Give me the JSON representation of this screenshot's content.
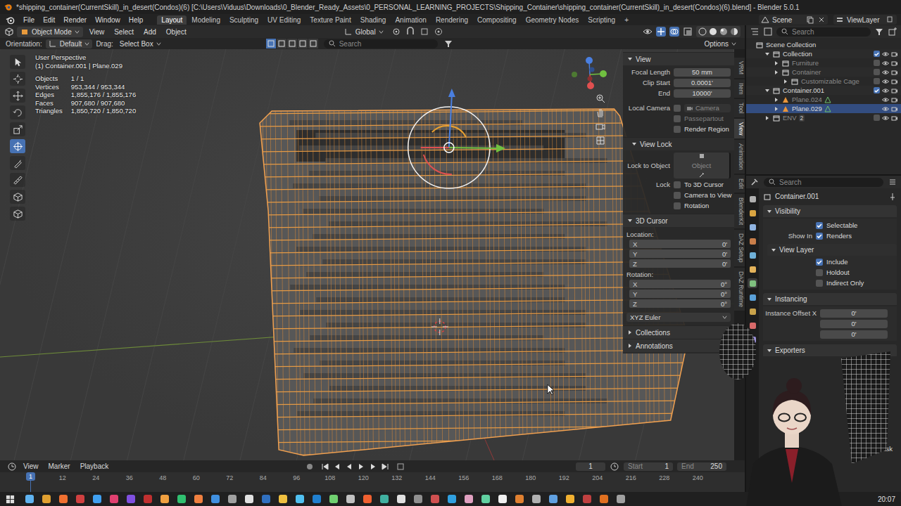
{
  "window": {
    "title": "*shipping_container(CurrentSkill)_in_desert(Condos)(6) [C:\\Users\\Viduus\\Downloads\\0_Blender_Ready_Assets\\0_PERSONAL_LEARNING_PROJECTS\\Shipping_Container\\shipping_container(CurrentSkill)_in_desert(Condos)(6).blend] - Blender 5.0.1"
  },
  "menu": [
    "File",
    "Edit",
    "Render",
    "Window",
    "Help"
  ],
  "workspaces": [
    {
      "label": "Layout",
      "selected": true
    },
    {
      "label": "Modeling",
      "selected": false
    },
    {
      "label": "Sculpting",
      "selected": false
    },
    {
      "label": "UV Editing",
      "selected": false
    },
    {
      "label": "Texture Paint",
      "selected": false
    },
    {
      "label": "Shading",
      "selected": false
    },
    {
      "label": "Animation",
      "selected": false
    },
    {
      "label": "Rendering",
      "selected": false
    },
    {
      "label": "Compositing",
      "selected": false
    },
    {
      "label": "Geometry Nodes",
      "selected": false
    },
    {
      "label": "Scripting",
      "selected": false
    }
  ],
  "add_workspace": "+",
  "scene": {
    "scene": "Scene",
    "view_layer": "ViewLayer"
  },
  "header": {
    "mode": "Object Mode",
    "menus": [
      "View",
      "Select",
      "Add",
      "Object"
    ],
    "transform": "Global"
  },
  "tool_settings": {
    "orientation_label": "Orientation:",
    "orientation": "Default",
    "drag_label": "Drag:",
    "drag": "Select Box",
    "search": "Search",
    "options": "Options"
  },
  "tools": [
    {
      "selected": false
    },
    {
      "selected": false
    },
    {
      "selected": false
    },
    {
      "selected": false
    },
    {
      "selected": false
    },
    {
      "selected": true
    },
    {
      "selected": false
    },
    {
      "selected": false
    },
    {
      "selected": false
    },
    {
      "selected": false
    }
  ],
  "viewport": {
    "perspective": "User Perspective",
    "active": "(1) Container.001 | Plane.029",
    "stats": [
      {
        "label": "Objects",
        "value": "1 / 1"
      },
      {
        "label": "Vertices",
        "value": "953,344 / 953,344"
      },
      {
        "label": "Edges",
        "value": "1,855,176 / 1,855,176"
      },
      {
        "label": "Faces",
        "value": "907,680 / 907,680"
      },
      {
        "label": "Triangles",
        "value": "1,850,720 / 1,850,720"
      }
    ]
  },
  "sidebar": {
    "view": {
      "title": "View",
      "expanded": true,
      "fields": [
        {
          "label": "Focal Length",
          "value": "50 mm"
        },
        {
          "label": "Clip Start",
          "value": "0.0001'"
        },
        {
          "label": "End",
          "value": "10000'"
        }
      ],
      "local_camera": {
        "label": "Local Camera",
        "checked": false,
        "value": "Camera"
      },
      "checks": [
        {
          "label": "Passepartout",
          "checked": false,
          "disabled": true
        },
        {
          "label": "Render Region",
          "checked": false,
          "disabled": false
        }
      ]
    },
    "view_lock": {
      "title": "View Lock",
      "expanded": true,
      "lock_to_label": "Lock to Object",
      "lock_to_value": "Object",
      "lock_label": "Lock",
      "checks": [
        {
          "label": "To 3D Cursor",
          "checked": false
        },
        {
          "label": "Camera to View",
          "checked": false
        },
        {
          "label": "Rotation",
          "checked": false
        }
      ]
    },
    "cursor": {
      "title": "3D Cursor",
      "expanded": true,
      "location_label": "Location:",
      "location": [
        {
          "axis": "X",
          "value": "0'"
        },
        {
          "axis": "Y",
          "value": "0'"
        },
        {
          "axis": "Z",
          "value": "0'"
        }
      ],
      "rotation_label": "Rotation:",
      "rotation": [
        {
          "axis": "X",
          "value": "0°"
        },
        {
          "axis": "Y",
          "value": "0°"
        },
        {
          "axis": "Z",
          "value": "0°"
        }
      ],
      "mode": "XYZ Euler"
    },
    "collapsed": [
      {
        "title": "Collections",
        "expanded": false
      },
      {
        "title": "Annotations",
        "expanded": false
      }
    ]
  },
  "sidebar_tabs": [
    {
      "label": "VRM",
      "selected": false
    },
    {
      "label": "Item",
      "selected": false
    },
    {
      "label": "Tool",
      "selected": false
    },
    {
      "label": "View",
      "selected": true
    },
    {
      "label": "Animation",
      "selected": false
    },
    {
      "label": "Edit",
      "selected": false
    },
    {
      "label": "BlenderKit",
      "selected": false
    },
    {
      "label": "DAZ Setup",
      "selected": false
    },
    {
      "label": "DAZ Runtime",
      "selected": false
    }
  ],
  "outliner": {
    "search": "Search",
    "items": [
      {
        "label": "Scene Collection",
        "kind": "scene",
        "depth": 0,
        "expanded": true,
        "selected": false,
        "dimmed": false
      },
      {
        "label": "Collection",
        "kind": "collection",
        "depth": 1,
        "expanded": true,
        "selected": false,
        "dimmed": false,
        "checked": true
      },
      {
        "label": "Furniture",
        "kind": "collection",
        "depth": 2,
        "expanded": false,
        "selected": false,
        "dimmed": true,
        "checked": false
      },
      {
        "label": "Container",
        "kind": "collection",
        "depth": 2,
        "expanded": false,
        "selected": false,
        "dimmed": true,
        "checked": false
      },
      {
        "label": "Customizable Cage",
        "kind": "collection",
        "depth": 3,
        "expanded": false,
        "selected": false,
        "dimmed": true,
        "checked": false
      },
      {
        "label": "Container.001",
        "kind": "collection",
        "depth": 1,
        "expanded": true,
        "selected": false,
        "dimmed": false,
        "checked": true
      },
      {
        "label": "Plane.024",
        "kind": "object",
        "depth": 2,
        "expanded": false,
        "selected": false,
        "dimmed": true
      },
      {
        "label": "Plane.029",
        "kind": "object",
        "depth": 2,
        "expanded": false,
        "selected": true,
        "dimmed": false
      },
      {
        "label": "ENV",
        "kind": "collection",
        "depth": 1,
        "expanded": false,
        "selected": false,
        "dimmed": true,
        "checked": false,
        "badge": "2"
      }
    ]
  },
  "properties": {
    "search": "Search",
    "object": "Container.001",
    "visibility": {
      "title": "Visibility",
      "expanded": true,
      "selectable": {
        "label": "Selectable",
        "checked": true
      },
      "show_in_label": "Show In",
      "renders": {
        "label": "Renders",
        "checked": true
      }
    },
    "view_layer": {
      "title": "View Layer",
      "expanded": true,
      "checks": [
        {
          "label": "Include",
          "checked": true
        },
        {
          "label": "Holdout",
          "checked": false
        },
        {
          "label": "Indirect Only",
          "checked": false
        }
      ]
    },
    "instancing": {
      "title": "Instancing",
      "expanded": true,
      "offset_label": "Instance Offset X",
      "offset": [
        "0'",
        "0'",
        "0'"
      ]
    },
    "exporters": {
      "title": "Exporters",
      "expanded": true
    },
    "partial": "ask"
  },
  "timeline": {
    "menus": [
      "View",
      "Marker",
      "Playback"
    ],
    "frame": "1",
    "start_label": "Start",
    "start": "1",
    "end_label": "End",
    "end": "250",
    "ticks": [
      "12",
      "24",
      "36",
      "48",
      "60",
      "72",
      "84",
      "96",
      "108",
      "120",
      "132",
      "144",
      "156",
      "168",
      "180",
      "192",
      "204",
      "216",
      "228",
      "240"
    ],
    "current": "1"
  },
  "taskbar": {
    "time": "20:07"
  }
}
